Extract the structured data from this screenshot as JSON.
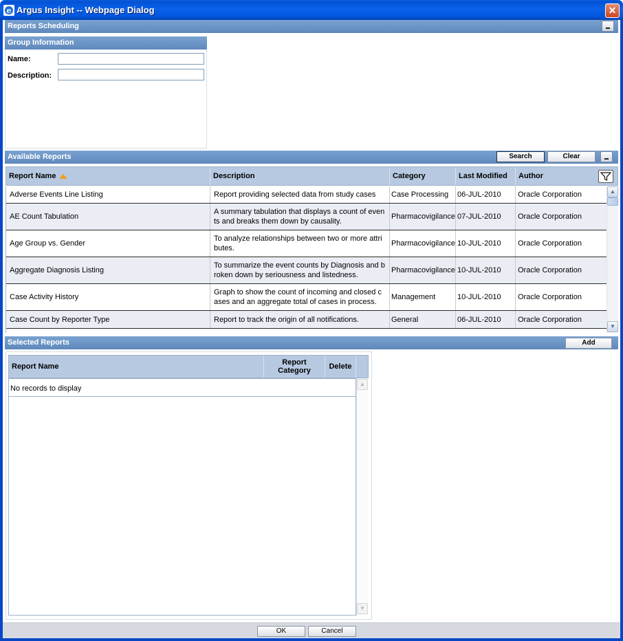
{
  "window": {
    "title": "Argus Insight -- Webpage Dialog",
    "close_glyph": "✕"
  },
  "scheduling": {
    "title": "Reports Scheduling"
  },
  "group": {
    "title": "Group Information",
    "name_label": "Name:",
    "name_value": "",
    "description_label": "Description:",
    "description_value": ""
  },
  "available": {
    "title": "Available Reports",
    "search_label": "Search",
    "clear_label": "Clear",
    "columns": {
      "name": "Report Name",
      "description": "Description",
      "category": "Category",
      "modified": "Last Modified",
      "author": "Author"
    },
    "rows": [
      {
        "name": "Adverse Events Line Listing",
        "description": "Report providing selected data from study cases",
        "category": "Case Processing",
        "modified": "06-JUL-2010",
        "author": "Oracle Corporation"
      },
      {
        "name": "AE Count Tabulation",
        "description": "A summary tabulation that displays a count of even ts and breaks them down by causality.",
        "category": "Pharmacovigilance",
        "modified": "07-JUL-2010",
        "author": "Oracle Corporation"
      },
      {
        "name": "Age Group vs. Gender",
        "description": "To analyze relationships between two or more attri butes.",
        "category": "Pharmacovigilance",
        "modified": "10-JUL-2010",
        "author": "Oracle Corporation"
      },
      {
        "name": "Aggregate Diagnosis Listing",
        "description": "To summarize the event counts by Diagnosis and b roken down by seriousness and listedness.",
        "category": "Pharmacovigilance",
        "modified": "10-JUL-2010",
        "author": "Oracle Corporation"
      },
      {
        "name": "Case Activity History",
        "description": "Graph to show the count of incoming and closed c ases and an aggregate total of cases in process.",
        "category": "Management",
        "modified": "10-JUL-2010",
        "author": "Oracle Corporation"
      },
      {
        "name": "Case Count by Reporter Type",
        "description": "Report to track the origin of all notifications.",
        "category": "General",
        "modified": "06-JUL-2010",
        "author": "Oracle Corporation"
      }
    ]
  },
  "selected": {
    "title": "Selected Reports",
    "add_label": "Add",
    "columns": {
      "name": "Report Name",
      "category": "Report Category",
      "delete": "Delete"
    },
    "empty_text": "No records to display"
  },
  "footer": {
    "ok_label": "OK",
    "cancel_label": "Cancel"
  },
  "icons": {
    "window": "ie-icon",
    "sort": "sort-ascending-icon",
    "filter": "filter-funnel-icon",
    "collapse": "minimize-icon"
  },
  "colors": {
    "title_bar": "#0a62e8",
    "section_bar": "#6b93c6",
    "grid_header": "#b7c9e1",
    "alt_row": "#ebedf5",
    "sort_icon": "#f0a01a"
  }
}
